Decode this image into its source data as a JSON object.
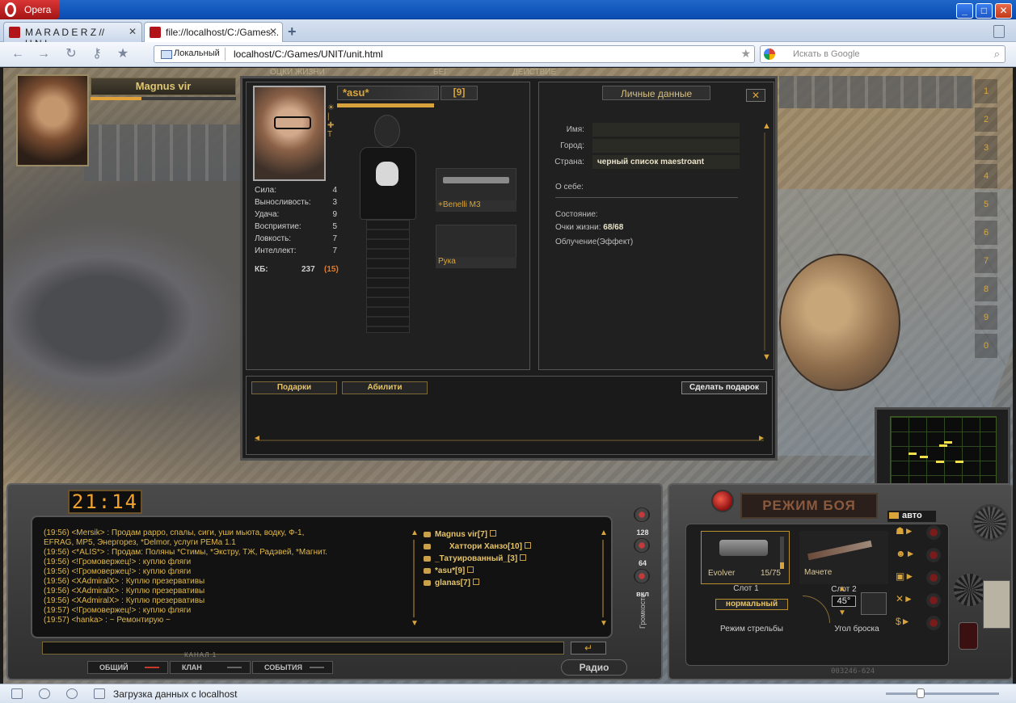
{
  "browser": {
    "app_name": "Opera",
    "tabs": [
      {
        "title": "M A R A D E R Z // U.N.I...."
      },
      {
        "title": "file://localhost/C:/Games..."
      }
    ],
    "location_label": "Локальный",
    "url": "localhost/C:/Games/UNIT/unit.html",
    "search_placeholder": "Искать в Google",
    "status_text": "Загрузка данных с localhost"
  },
  "game": {
    "top_menu": [
      "ОЦКИ ЖИЗНИ",
      "БЕГ",
      "ДЕЙСТВИЕ"
    ],
    "player_name": "Magnus vir",
    "character": {
      "name": "*asu*",
      "level": "[9]",
      "stats": [
        {
          "label": "Сила:",
          "value": "4"
        },
        {
          "label": "Выносливость:",
          "value": "3"
        },
        {
          "label": "Удача:",
          "value": "9"
        },
        {
          "label": "Восприятие:",
          "value": "5"
        },
        {
          "label": "Ловкость:",
          "value": "7"
        },
        {
          "label": "Интеллект:",
          "value": "7"
        }
      ],
      "kb_label": "КБ:",
      "kb_value": "237",
      "kb_bonus": "(15)",
      "weapon_label": "+Benelli M3",
      "hand_label": "Рука"
    },
    "personal": {
      "title": "Личные данные",
      "close": "✕",
      "name_label": "Имя:",
      "city_label": "Город:",
      "country_label": "Страна:",
      "country_value": "черный список maestroant",
      "about_label": "О себе:",
      "state_label": "Состояние:",
      "hp_label": "Очки жизни:",
      "hp_value": "68/68",
      "radiation_label": "Облучение(Эффект)"
    },
    "gifts": {
      "tab1": "Подарки",
      "tab2": "Абилити",
      "make_gift": "Сделать подарок"
    },
    "quickslots": [
      "1",
      "2",
      "3",
      "4",
      "5",
      "6",
      "7",
      "8",
      "9",
      "0"
    ],
    "clock": "21:14",
    "chat": [
      "(19:56) <Mersik> : Продам рарро, спалы, сиги, уши мьюта, водку, Ф-1,",
      "EFRAG, MP5, Энергорез, *Delmor, услуги РЕМа 1.1",
      "(19:56) <*ALIS*> : Продам: Поляны *Стимы, *Экстру, ТЖ, Радэвей, *Магнит.",
      "(19:56) <!Громовержец!> : куплю фляги",
      "(19:56) <!Громовержец!> : куплю фляги",
      "(19:56) <XAdmiralX> : Куплю презервативы",
      "(19:56) <XAdmiralX> : Куплю презервативы",
      "(19:56) <XAdmiralX> : Куплю презервативы",
      "(19:57) <!Громовержец!> : куплю фляги",
      "(19:57) <hanka> : ~ Ремонтирую ~"
    ],
    "users": [
      {
        "name": "Magnus vir[7]"
      },
      {
        "name": "Хаттори Ханзо[10]"
      },
      {
        "name": "_Татуированный_[3]"
      },
      {
        "name": "*asu*[9]"
      },
      {
        "name": "glanas[7]"
      }
    ],
    "volume": [
      "128",
      "64",
      "вкл"
    ],
    "volume_word": "Громкость",
    "channel_label": "КАНАЛ 1",
    "channels": [
      "ОБЩИЙ",
      "КЛАН",
      "СОБЫТИЯ"
    ],
    "radio": "Радио",
    "combat": {
      "title": "РЕЖИМ БОЯ",
      "auto": "авто",
      "slot1_name": "Evolver",
      "slot1_count": "15/75",
      "slot1_label": "Слот 1",
      "slot2_name": "Мачете",
      "slot2_label": "Слот 2",
      "fire_mode": "нормальный",
      "fire_label": "Режим стрельбы",
      "angle": "45°",
      "angle_label": "Угол броска",
      "serial": "003246-624"
    }
  },
  "values": {
    "left_hp_fill": 0.35,
    "char_hp_fill": 1.0,
    "ammo_fill": 0.2
  }
}
